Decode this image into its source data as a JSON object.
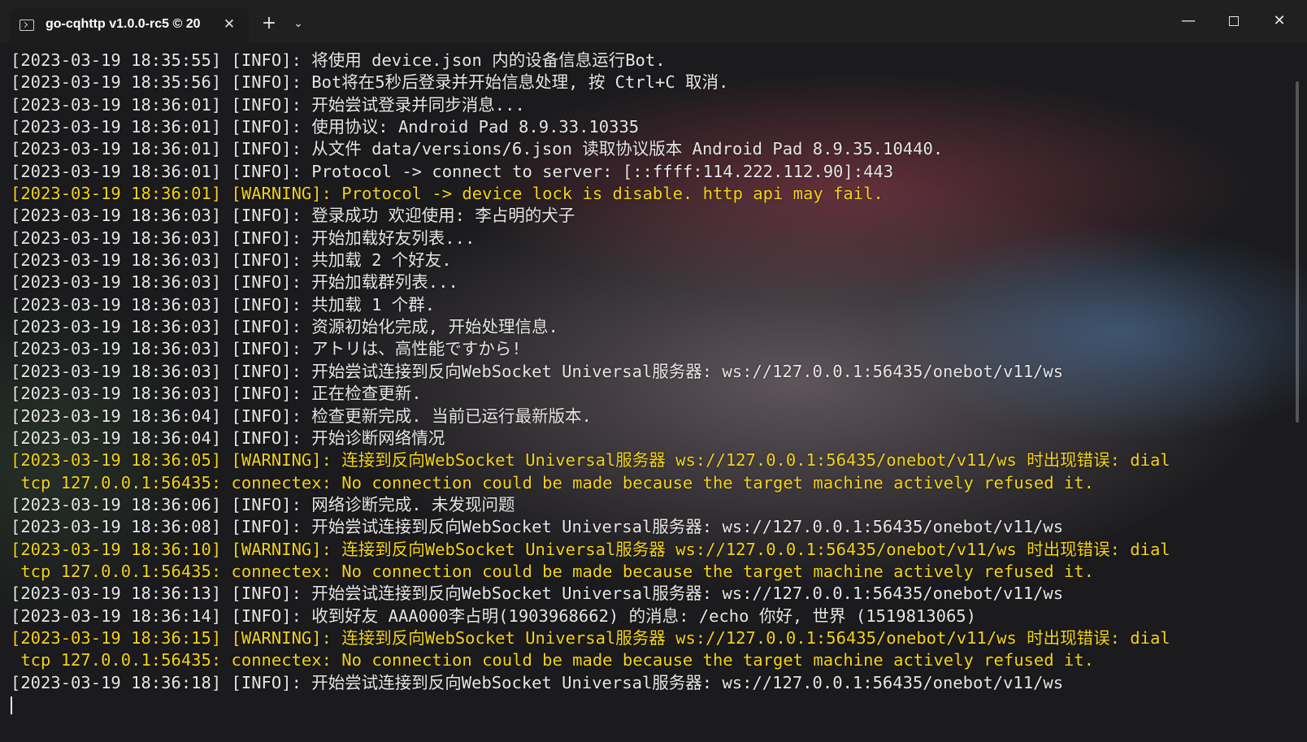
{
  "window": {
    "tab_title": "go-cqhttp v1.0.0-rc5 © 20",
    "tab_close": "✕",
    "new_tab": "+",
    "dropdown": "⌄",
    "minimize": "—",
    "close": "✕"
  },
  "colors": {
    "info_text": "#e6e6e6",
    "warning_text": "#f3d21a",
    "titlebar": "#202020"
  },
  "icons": {
    "tab": "terminal-icon",
    "new_tab": "plus-icon",
    "dropdown": "chevron-down-icon",
    "minimize": "minimize-icon",
    "maximize": "maximize-icon",
    "close": "close-icon"
  },
  "console": {
    "lines": [
      {
        "text": "[2023-03-19 18:35:55] [INFO]: 将使用 device.json 内的设备信息运行Bot.",
        "level": "info"
      },
      {
        "text": "[2023-03-19 18:35:56] [INFO]: Bot将在5秒后登录并开始信息处理, 按 Ctrl+C 取消.",
        "level": "info"
      },
      {
        "text": "[2023-03-19 18:36:01] [INFO]: 开始尝试登录并同步消息...",
        "level": "info"
      },
      {
        "text": "[2023-03-19 18:36:01] [INFO]: 使用协议: Android Pad 8.9.33.10335",
        "level": "info"
      },
      {
        "text": "[2023-03-19 18:36:01] [INFO]: 从文件 data/versions/6.json 读取协议版本 Android Pad 8.9.35.10440.",
        "level": "info"
      },
      {
        "text": "[2023-03-19 18:36:01] [INFO]: Protocol -> connect to server: [::ffff:114.222.112.90]:443",
        "level": "info"
      },
      {
        "text": "[2023-03-19 18:36:01] [WARNING]: Protocol -> device lock is disable. http api may fail.",
        "level": "warning"
      },
      {
        "text": "[2023-03-19 18:36:03] [INFO]: 登录成功 欢迎使用: 李占明的犬子",
        "level": "info"
      },
      {
        "text": "[2023-03-19 18:36:03] [INFO]: 开始加载好友列表...",
        "level": "info"
      },
      {
        "text": "[2023-03-19 18:36:03] [INFO]: 共加载 2 个好友.",
        "level": "info"
      },
      {
        "text": "[2023-03-19 18:36:03] [INFO]: 开始加载群列表...",
        "level": "info"
      },
      {
        "text": "[2023-03-19 18:36:03] [INFO]: 共加载 1 个群.",
        "level": "info"
      },
      {
        "text": "[2023-03-19 18:36:03] [INFO]: 资源初始化完成, 开始处理信息.",
        "level": "info"
      },
      {
        "text": "[2023-03-19 18:36:03] [INFO]: アトリは、高性能ですから!",
        "level": "info"
      },
      {
        "text": "[2023-03-19 18:36:03] [INFO]: 开始尝试连接到反向WebSocket Universal服务器: ws://127.0.0.1:56435/onebot/v11/ws",
        "level": "info"
      },
      {
        "text": "[2023-03-19 18:36:03] [INFO]: 正在检查更新.",
        "level": "info"
      },
      {
        "text": "[2023-03-19 18:36:04] [INFO]: 检查更新完成. 当前已运行最新版本.",
        "level": "info"
      },
      {
        "text": "[2023-03-19 18:36:04] [INFO]: 开始诊断网络情况",
        "level": "info"
      },
      {
        "text": "[2023-03-19 18:36:05] [WARNING]: 连接到反向WebSocket Universal服务器 ws://127.0.0.1:56435/onebot/v11/ws 时出现错误: dial",
        "level": "warning"
      },
      {
        "text": " tcp 127.0.0.1:56435: connectex: No connection could be made because the target machine actively refused it.",
        "level": "warning"
      },
      {
        "text": "[2023-03-19 18:36:06] [INFO]: 网络诊断完成. 未发现问题",
        "level": "info"
      },
      {
        "text": "[2023-03-19 18:36:08] [INFO]: 开始尝试连接到反向WebSocket Universal服务器: ws://127.0.0.1:56435/onebot/v11/ws",
        "level": "info"
      },
      {
        "text": "[2023-03-19 18:36:10] [WARNING]: 连接到反向WebSocket Universal服务器 ws://127.0.0.1:56435/onebot/v11/ws 时出现错误: dial",
        "level": "warning"
      },
      {
        "text": " tcp 127.0.0.1:56435: connectex: No connection could be made because the target machine actively refused it.",
        "level": "warning"
      },
      {
        "text": "[2023-03-19 18:36:13] [INFO]: 开始尝试连接到反向WebSocket Universal服务器: ws://127.0.0.1:56435/onebot/v11/ws",
        "level": "info"
      },
      {
        "text": "[2023-03-19 18:36:14] [INFO]: 收到好友 AAA000李占明(1903968662) 的消息: /echo 你好, 世界 (1519813065)",
        "level": "info"
      },
      {
        "text": "[2023-03-19 18:36:15] [WARNING]: 连接到反向WebSocket Universal服务器 ws://127.0.0.1:56435/onebot/v11/ws 时出现错误: dial",
        "level": "warning"
      },
      {
        "text": " tcp 127.0.0.1:56435: connectex: No connection could be made because the target machine actively refused it.",
        "level": "warning"
      },
      {
        "text": "[2023-03-19 18:36:18] [INFO]: 开始尝试连接到反向WebSocket Universal服务器: ws://127.0.0.1:56435/onebot/v11/ws",
        "level": "info"
      }
    ]
  }
}
